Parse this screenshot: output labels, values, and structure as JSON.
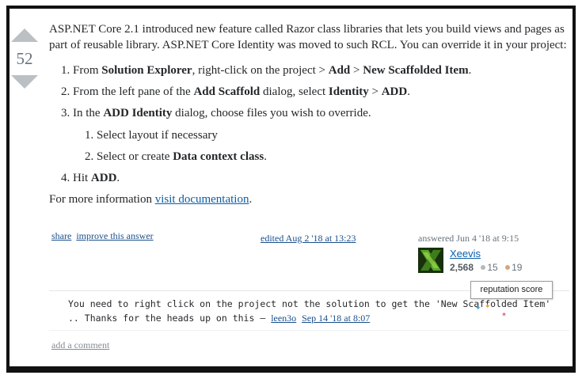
{
  "vote": {
    "count": "52"
  },
  "answer": {
    "intro": "ASP.NET Core 2.1 introduced new feature called Razor class libraries that lets you build views and pages as part of reusable library. ASP.NET Core Identity was moved to such RCL. You can override it in your project:",
    "steps": [
      {
        "pre": "From ",
        "b1": "Solution Explorer",
        "mid": ", right-click on the project > ",
        "b2": "Add",
        "mid2": " > ",
        "b3": "New Scaffolded Item",
        "post": "."
      },
      {
        "pre": "From the left pane of the ",
        "b1": "Add Scaffold",
        "mid": " dialog, select ",
        "b2": "Identity",
        "mid2": " > ",
        "b3": "ADD",
        "post": "."
      },
      {
        "pre": "In the ",
        "b1": "ADD Identity",
        "post": " dialog, choose files you wish to override."
      },
      {
        "pre": "Hit ",
        "b1": "ADD",
        "post": "."
      }
    ],
    "substeps": [
      {
        "text": "Select layout if necessary"
      },
      {
        "pre": "Select or create ",
        "b1": "Data context class",
        "post": "."
      }
    ],
    "more_pre": "For more information ",
    "more_link": "visit documentation",
    "more_post": "."
  },
  "meta": {
    "share": "share",
    "improve": "improve this answer",
    "edited": "edited Aug 2 '18 at 13:23",
    "answered": "answered Jun 4 '18 at 9:15"
  },
  "user": {
    "name": "Xeevis",
    "reputation": "2,568",
    "silver": "15",
    "bronze": "19"
  },
  "tooltip": "reputation score",
  "comment": {
    "text": "You need to right click on the project not the solution to get the 'New Scaffolded Item' .. Thanks for the heads up on this –",
    "author": "leen3o",
    "date": "Sep 14 '18 at 8:07"
  },
  "add_comment": "add a comment",
  "colors": {
    "link": "#0b5ea8",
    "vote_arrow": "#bbc0c4",
    "silver": "#b4b8bc",
    "bronze": "#d1a684"
  }
}
